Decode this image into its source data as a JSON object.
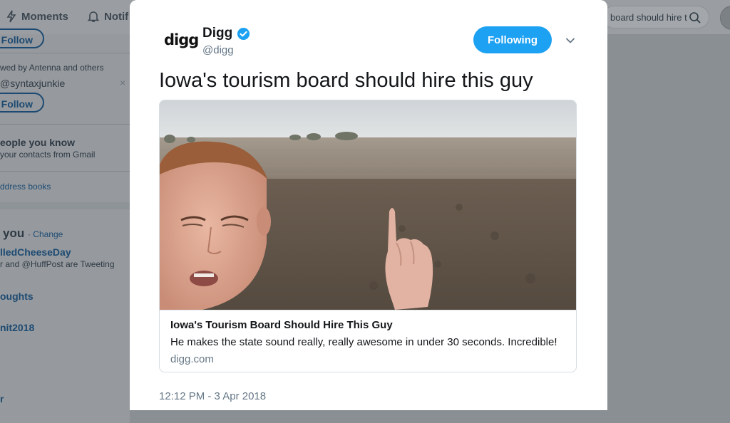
{
  "background": {
    "nav": [
      {
        "label": "Moments",
        "icon": "lightning-icon"
      },
      {
        "label": "Notif",
        "icon": "bell-icon"
      }
    ],
    "search_value": "board should hire t",
    "left": {
      "follow_label_1": "Follow",
      "followed_by": "wed by Antenna and others",
      "handle": "@syntaxjunkie",
      "follow_label_2": "Follow",
      "people_title": "eople you know",
      "people_sub": "your contacts from Gmail",
      "address_books": "ddress books",
      "trends_title": "you",
      "trends_change": "· Change",
      "trend1": "lledCheeseDay",
      "trend1_sub": "r and @HuffPost are Tweeting",
      "trend2": "oughts",
      "trend3": "nit2018",
      "trend4": "r"
    }
  },
  "tweet": {
    "logo_text": "digg",
    "author_name": "Digg",
    "author_handle": "@digg",
    "follow_button": "Following",
    "text": "Iowa's tourism board should hire this guy",
    "card": {
      "title": "Iowa's Tourism Board Should Hire This Guy",
      "description": "He makes the state sound really, really awesome in under 30 seconds. Incredible!",
      "domain": "digg.com"
    },
    "timestamp": "12:12 PM - 3 Apr 2018"
  },
  "colors": {
    "accent": "#1da1f2",
    "secondary_text": "#657786",
    "overlay": "#8a8f94"
  }
}
